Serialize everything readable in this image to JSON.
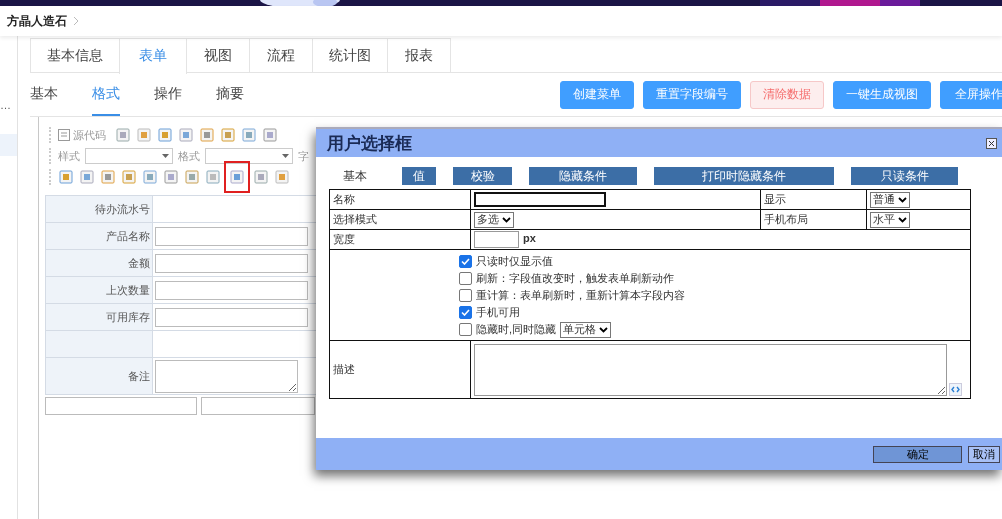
{
  "breadcrumb": {
    "items": [
      "方晶人造石"
    ]
  },
  "sidebar": {
    "items": [
      {
        "label": "…",
        "selected": false
      },
      {
        "selected": true
      }
    ]
  },
  "tabs": [
    {
      "label": "基本信息",
      "selected": false
    },
    {
      "label": "表单",
      "selected": true
    },
    {
      "label": "视图",
      "selected": false
    },
    {
      "label": "流程",
      "selected": false
    },
    {
      "label": "统计图",
      "selected": false
    },
    {
      "label": "报表",
      "selected": false
    }
  ],
  "subtabs": [
    {
      "label": "基本",
      "selected": false
    },
    {
      "label": "格式",
      "selected": true
    },
    {
      "label": "操作",
      "selected": false
    },
    {
      "label": "摘要",
      "selected": false
    }
  ],
  "actions": [
    {
      "label": "创建菜单",
      "kind": "primary"
    },
    {
      "label": "重置字段编号",
      "kind": "primary"
    },
    {
      "label": "清除数据",
      "kind": "danger"
    },
    {
      "label": "一键生成视图",
      "kind": "primary"
    },
    {
      "label": "全屏操作",
      "kind": "primary"
    }
  ],
  "editor": {
    "toolbar": {
      "source_label": "源代码",
      "style_label": "样式",
      "format_label": "格式",
      "font_label": "字",
      "row1_tools": [
        {
          "highlighted": false
        },
        {
          "highlighted": false
        },
        {
          "highlighted": false
        },
        {
          "highlighted": false
        },
        {
          "highlighted": false
        },
        {
          "highlighted": false
        },
        {
          "highlighted": false
        },
        {
          "highlighted": false
        }
      ],
      "row3_tools": [
        {
          "highlighted": false
        },
        {
          "highlighted": false
        },
        {
          "highlighted": false
        },
        {
          "highlighted": false
        },
        {
          "highlighted": false
        },
        {
          "highlighted": false
        },
        {
          "highlighted": false
        },
        {
          "highlighted": false
        },
        {
          "highlighted": true
        },
        {
          "highlighted": false
        },
        {
          "highlighted": false
        }
      ]
    },
    "rows": [
      {
        "label": "待办流水号",
        "kind": "text"
      },
      {
        "label": "产品名称",
        "kind": "input"
      },
      {
        "label": "金额",
        "kind": "input"
      },
      {
        "label": "上次数量",
        "kind": "input"
      },
      {
        "label": "可用库存",
        "kind": "input"
      },
      {
        "kind": "blank"
      },
      {
        "label": "备注",
        "kind": "textarea"
      }
    ],
    "footer_fields": [
      {
        "kind": "input"
      },
      {
        "kind": "input"
      }
    ]
  },
  "dialog": {
    "title": "用户选择框",
    "tabs": [
      {
        "label": "基本",
        "selected": true
      },
      {
        "label": "值",
        "selected": false
      },
      {
        "label": "校验",
        "selected": false
      },
      {
        "label": "隐藏条件",
        "selected": false
      },
      {
        "label": "打印时隐藏条件",
        "selected": false
      },
      {
        "label": "只读条件",
        "selected": false
      }
    ],
    "name": {
      "label": "名称",
      "focused": true
    },
    "display": {
      "label": "显示",
      "value": "普通"
    },
    "select_mode": {
      "label": "选择模式",
      "value": "多选"
    },
    "mobile_layout": {
      "label": "手机布局",
      "value": "水平"
    },
    "width": {
      "label": "宽度",
      "unit": "px"
    },
    "options": [
      {
        "kind": "checkbox",
        "label": "只读时仅显示值",
        "checked": true
      },
      {
        "kind": "checkbox",
        "label": "刷新：字段值改变时，触发表单刷新动作",
        "checked": false
      },
      {
        "kind": "checkbox",
        "label": "重计算：表单刷新时，重新计算本字段内容",
        "checked": false
      },
      {
        "kind": "checkbox",
        "label": "手机可用",
        "checked": true
      },
      {
        "kind": "checkbox-select",
        "label": "隐藏时,同时隐藏",
        "checked": false,
        "value": "单元格"
      }
    ],
    "description": {
      "label": "描述"
    },
    "buttons": [
      {
        "label": "确定",
        "kind": "primary"
      },
      {
        "label": "取消",
        "kind": "plain"
      }
    ]
  }
}
